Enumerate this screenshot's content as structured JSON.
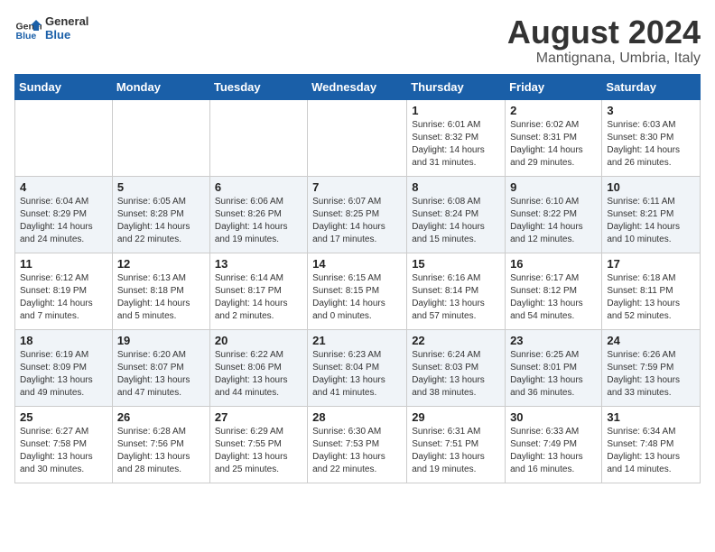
{
  "logo": {
    "line1": "General",
    "line2": "Blue"
  },
  "title": "August 2024",
  "subtitle": "Mantignana, Umbria, Italy",
  "days_of_week": [
    "Sunday",
    "Monday",
    "Tuesday",
    "Wednesday",
    "Thursday",
    "Friday",
    "Saturday"
  ],
  "weeks": [
    [
      {
        "day": "",
        "content": ""
      },
      {
        "day": "",
        "content": ""
      },
      {
        "day": "",
        "content": ""
      },
      {
        "day": "",
        "content": ""
      },
      {
        "day": "1",
        "content": "Sunrise: 6:01 AM\nSunset: 8:32 PM\nDaylight: 14 hours\nand 31 minutes."
      },
      {
        "day": "2",
        "content": "Sunrise: 6:02 AM\nSunset: 8:31 PM\nDaylight: 14 hours\nand 29 minutes."
      },
      {
        "day": "3",
        "content": "Sunrise: 6:03 AM\nSunset: 8:30 PM\nDaylight: 14 hours\nand 26 minutes."
      }
    ],
    [
      {
        "day": "4",
        "content": "Sunrise: 6:04 AM\nSunset: 8:29 PM\nDaylight: 14 hours\nand 24 minutes."
      },
      {
        "day": "5",
        "content": "Sunrise: 6:05 AM\nSunset: 8:28 PM\nDaylight: 14 hours\nand 22 minutes."
      },
      {
        "day": "6",
        "content": "Sunrise: 6:06 AM\nSunset: 8:26 PM\nDaylight: 14 hours\nand 19 minutes."
      },
      {
        "day": "7",
        "content": "Sunrise: 6:07 AM\nSunset: 8:25 PM\nDaylight: 14 hours\nand 17 minutes."
      },
      {
        "day": "8",
        "content": "Sunrise: 6:08 AM\nSunset: 8:24 PM\nDaylight: 14 hours\nand 15 minutes."
      },
      {
        "day": "9",
        "content": "Sunrise: 6:10 AM\nSunset: 8:22 PM\nDaylight: 14 hours\nand 12 minutes."
      },
      {
        "day": "10",
        "content": "Sunrise: 6:11 AM\nSunset: 8:21 PM\nDaylight: 14 hours\nand 10 minutes."
      }
    ],
    [
      {
        "day": "11",
        "content": "Sunrise: 6:12 AM\nSunset: 8:19 PM\nDaylight: 14 hours\nand 7 minutes."
      },
      {
        "day": "12",
        "content": "Sunrise: 6:13 AM\nSunset: 8:18 PM\nDaylight: 14 hours\nand 5 minutes."
      },
      {
        "day": "13",
        "content": "Sunrise: 6:14 AM\nSunset: 8:17 PM\nDaylight: 14 hours\nand 2 minutes."
      },
      {
        "day": "14",
        "content": "Sunrise: 6:15 AM\nSunset: 8:15 PM\nDaylight: 14 hours\nand 0 minutes."
      },
      {
        "day": "15",
        "content": "Sunrise: 6:16 AM\nSunset: 8:14 PM\nDaylight: 13 hours\nand 57 minutes."
      },
      {
        "day": "16",
        "content": "Sunrise: 6:17 AM\nSunset: 8:12 PM\nDaylight: 13 hours\nand 54 minutes."
      },
      {
        "day": "17",
        "content": "Sunrise: 6:18 AM\nSunset: 8:11 PM\nDaylight: 13 hours\nand 52 minutes."
      }
    ],
    [
      {
        "day": "18",
        "content": "Sunrise: 6:19 AM\nSunset: 8:09 PM\nDaylight: 13 hours\nand 49 minutes."
      },
      {
        "day": "19",
        "content": "Sunrise: 6:20 AM\nSunset: 8:07 PM\nDaylight: 13 hours\nand 47 minutes."
      },
      {
        "day": "20",
        "content": "Sunrise: 6:22 AM\nSunset: 8:06 PM\nDaylight: 13 hours\nand 44 minutes."
      },
      {
        "day": "21",
        "content": "Sunrise: 6:23 AM\nSunset: 8:04 PM\nDaylight: 13 hours\nand 41 minutes."
      },
      {
        "day": "22",
        "content": "Sunrise: 6:24 AM\nSunset: 8:03 PM\nDaylight: 13 hours\nand 38 minutes."
      },
      {
        "day": "23",
        "content": "Sunrise: 6:25 AM\nSunset: 8:01 PM\nDaylight: 13 hours\nand 36 minutes."
      },
      {
        "day": "24",
        "content": "Sunrise: 6:26 AM\nSunset: 7:59 PM\nDaylight: 13 hours\nand 33 minutes."
      }
    ],
    [
      {
        "day": "25",
        "content": "Sunrise: 6:27 AM\nSunset: 7:58 PM\nDaylight: 13 hours\nand 30 minutes."
      },
      {
        "day": "26",
        "content": "Sunrise: 6:28 AM\nSunset: 7:56 PM\nDaylight: 13 hours\nand 28 minutes."
      },
      {
        "day": "27",
        "content": "Sunrise: 6:29 AM\nSunset: 7:55 PM\nDaylight: 13 hours\nand 25 minutes."
      },
      {
        "day": "28",
        "content": "Sunrise: 6:30 AM\nSunset: 7:53 PM\nDaylight: 13 hours\nand 22 minutes."
      },
      {
        "day": "29",
        "content": "Sunrise: 6:31 AM\nSunset: 7:51 PM\nDaylight: 13 hours\nand 19 minutes."
      },
      {
        "day": "30",
        "content": "Sunrise: 6:33 AM\nSunset: 7:49 PM\nDaylight: 13 hours\nand 16 minutes."
      },
      {
        "day": "31",
        "content": "Sunrise: 6:34 AM\nSunset: 7:48 PM\nDaylight: 13 hours\nand 14 minutes."
      }
    ]
  ]
}
